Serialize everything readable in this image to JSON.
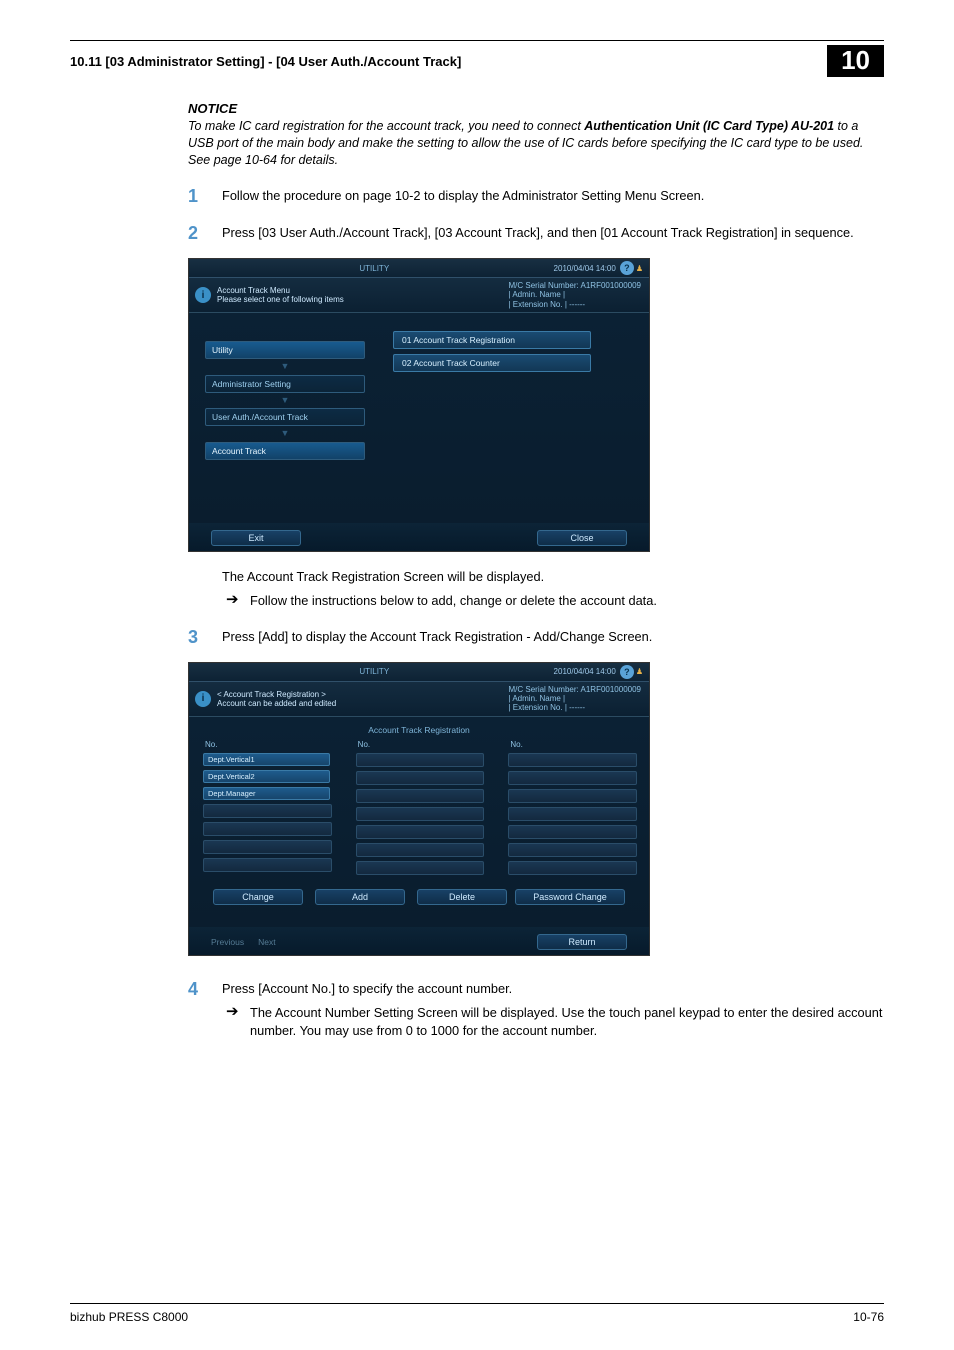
{
  "header": {
    "section": "10.11    [03 Administrator Setting] - [04 User Auth./Account Track]",
    "chapter_box": "10"
  },
  "notice": {
    "title": "NOTICE",
    "body_prefix": "To make IC card registration for the account track, you need to connect ",
    "body_bold": "Authentication Unit (IC Card Type) AU-201",
    "body_suffix": " to a USB port of the main body and make the setting to allow the use of IC cards before specifying the IC card type to be used. See page 10-64 for details."
  },
  "steps": {
    "s1": {
      "num": "1",
      "text": "Follow the procedure on page 10-2 to display the Administrator Setting Menu Screen."
    },
    "s2": {
      "num": "2",
      "text": "Press [03 User Auth./Account Track], [03 Account Track], and then [01 Account Track Registration] in sequence."
    },
    "s2_after1": "The Account Track Registration Screen will be displayed.",
    "s2_after2": "Follow the instructions below to add, change or delete the account data.",
    "s3": {
      "num": "3",
      "text": "Press [Add] to display the Account Track Registration - Add/Change Screen."
    },
    "s4": {
      "num": "4",
      "text": "Press [Account No.] to specify the account number."
    },
    "s4_sub": "The Account Number Setting Screen will be displayed. Use the touch panel keypad to enter the desired account number. You may use from 0 to 1000 for the account number."
  },
  "shot1": {
    "topbar_center": "UTILITY",
    "topbar_right": "2010/04/04  14:00",
    "info_line1": "Account Track Menu",
    "info_line2": "Please select one of following items",
    "serial": "M/C Serial Number:  A1RF001000009",
    "admin": "| Admin. Name  |",
    "ext": "| Extension No. | ------",
    "crumbs": [
      "Utility",
      "Administrator Setting",
      "User Auth./Account Track",
      "Account Track"
    ],
    "menu": [
      "01 Account Track Registration",
      "02 Account Track Counter"
    ],
    "exit": "Exit",
    "close": "Close"
  },
  "shot2": {
    "topbar_center": "UTILITY",
    "topbar_right": "2010/04/04  14:00",
    "info_line1": "< Account Track Registration >",
    "info_line2": "Account can be added and edited",
    "serial": "M/C Serial Number:  A1RF001000009",
    "admin": "| Admin. Name  |",
    "ext": "| Extension No. | ------",
    "pane_title": "Account Track Registration",
    "colhead": "No.",
    "rows": [
      "Dept.Vertical1",
      "Dept.Vertical2",
      "Dept.Manager"
    ],
    "btn_change": "Change",
    "btn_add": "Add",
    "btn_delete": "Delete",
    "btn_pwchg": "Password Change",
    "prev": "Previous",
    "next": "Next",
    "return": "Return"
  },
  "footer": {
    "left": "bizhub PRESS C8000",
    "right": "10-76"
  }
}
